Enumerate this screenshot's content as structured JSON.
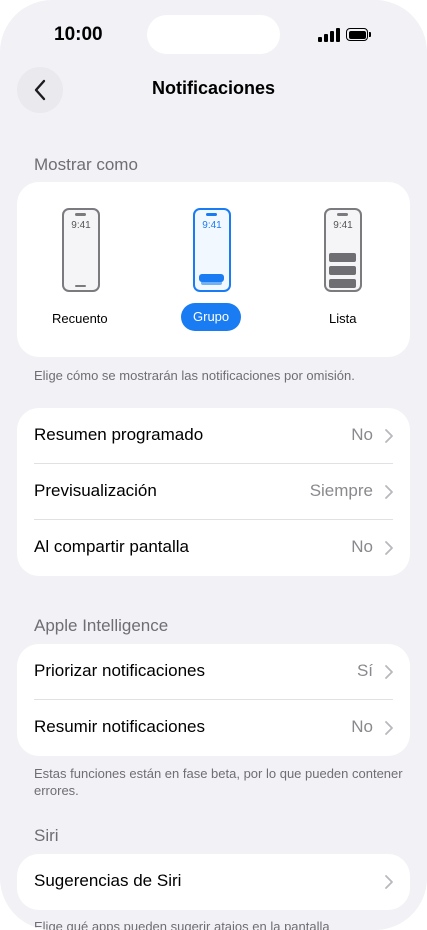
{
  "status_bar": {
    "time": "10:00"
  },
  "nav": {
    "title": "Notificaciones"
  },
  "show_as": {
    "header": "Mostrar como",
    "options": [
      {
        "label": "Recuento",
        "clock": "9:41"
      },
      {
        "label": "Grupo",
        "clock": "9:41"
      },
      {
        "label": "Lista",
        "clock": "9:41"
      }
    ],
    "selected": "Grupo",
    "footnote": "Elige cómo se mostrarán las notificaciones por omisión."
  },
  "general_rows": [
    {
      "label": "Resumen programado",
      "value": "No"
    },
    {
      "label": "Previsualización",
      "value": "Siempre"
    },
    {
      "label": "Al compartir pantalla",
      "value": "No"
    }
  ],
  "apple_intelligence": {
    "header": "Apple Intelligence",
    "rows": [
      {
        "label": "Priorizar notificaciones",
        "value": "Sí"
      },
      {
        "label": "Resumir notificaciones",
        "value": "No"
      }
    ],
    "footnote": "Estas funciones están en fase beta, por lo que pueden contener errores."
  },
  "siri": {
    "header": "Siri",
    "rows": [
      {
        "label": "Sugerencias de Siri",
        "value": ""
      }
    ],
    "footnote": "Elige qué apps pueden sugerir atajos en la pantalla"
  },
  "colors": {
    "accent": "#1a7cf2",
    "background": "#f1f1f6",
    "card": "#ffffff",
    "secondary_text": "#6e6e73"
  },
  "icons": [
    "back-chevron-icon",
    "signal-icon",
    "battery-icon",
    "chevron-right-icon"
  ]
}
